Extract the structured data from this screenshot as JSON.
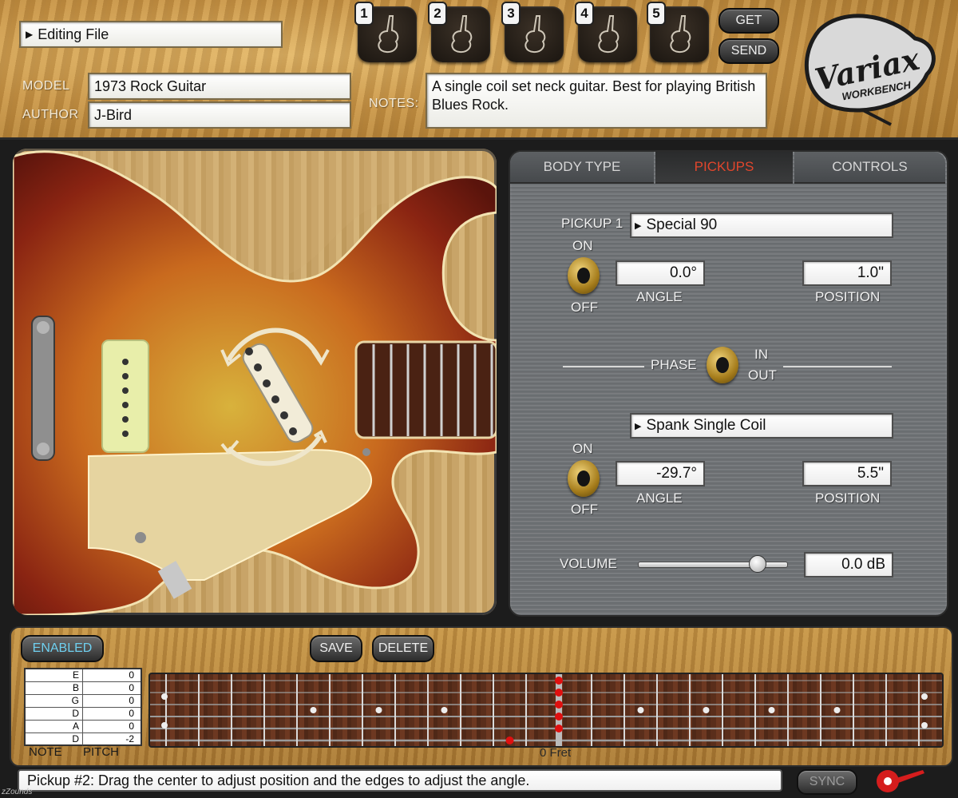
{
  "header": {
    "file_menu": "Editing File",
    "model_label": "MODEL",
    "model_value": "1973 Rock Guitar",
    "author_label": "AUTHOR",
    "author_value": "J-Bird",
    "notes_label": "NOTES:",
    "notes_value": "A single coil set neck guitar.  Best for playing British Blues Rock.",
    "presets": [
      "1",
      "2",
      "3",
      "4",
      "5"
    ],
    "get_label": "GET",
    "send_label": "SEND",
    "logo_text": "Variax",
    "logo_sub": "WORKBENCH"
  },
  "tabs": [
    {
      "label": "BODY TYPE",
      "active": false
    },
    {
      "label": "PICKUPS",
      "active": true
    },
    {
      "label": "CONTROLS",
      "active": false
    }
  ],
  "pickup1": {
    "label": "PICKUP 1",
    "type": "Special 90",
    "on_label": "ON",
    "off_label": "OFF",
    "angle_value": "0.0°",
    "angle_label": "ANGLE",
    "position_value": "1.0\"",
    "position_label": "POSITION"
  },
  "phase": {
    "label": "PHASE",
    "in_label": "IN",
    "out_label": "OUT"
  },
  "pickup2": {
    "type": "Spank Single Coil",
    "on_label": "ON",
    "off_label": "OFF",
    "angle_value": "-29.7°",
    "angle_label": "ANGLE",
    "position_value": "5.5\"",
    "position_label": "POSITION"
  },
  "volume": {
    "label": "VOLUME",
    "value": "0.0 dB",
    "slider_level": 0.83
  },
  "bottom": {
    "enabled_label": "ENABLED",
    "save_label": "SAVE",
    "delete_label": "DELETE",
    "tuning": [
      {
        "note": "E",
        "pitch": "0"
      },
      {
        "note": "B",
        "pitch": "0"
      },
      {
        "note": "G",
        "pitch": "0"
      },
      {
        "note": "D",
        "pitch": "0"
      },
      {
        "note": "A",
        "pitch": "0"
      },
      {
        "note": "D",
        "pitch": "-2"
      }
    ],
    "note_header": "NOTE",
    "pitch_header": "PITCH",
    "fret_label": "0 Fret"
  },
  "status": {
    "message": "Pickup #2: Drag the center to adjust position and the edges to adjust the angle.",
    "sync_label": "SYNC",
    "brand": "zZounds"
  },
  "colors": {
    "active_tab": "#e2462c",
    "enabled_text": "#6fd0f0",
    "fret_marker": "#e01010"
  }
}
